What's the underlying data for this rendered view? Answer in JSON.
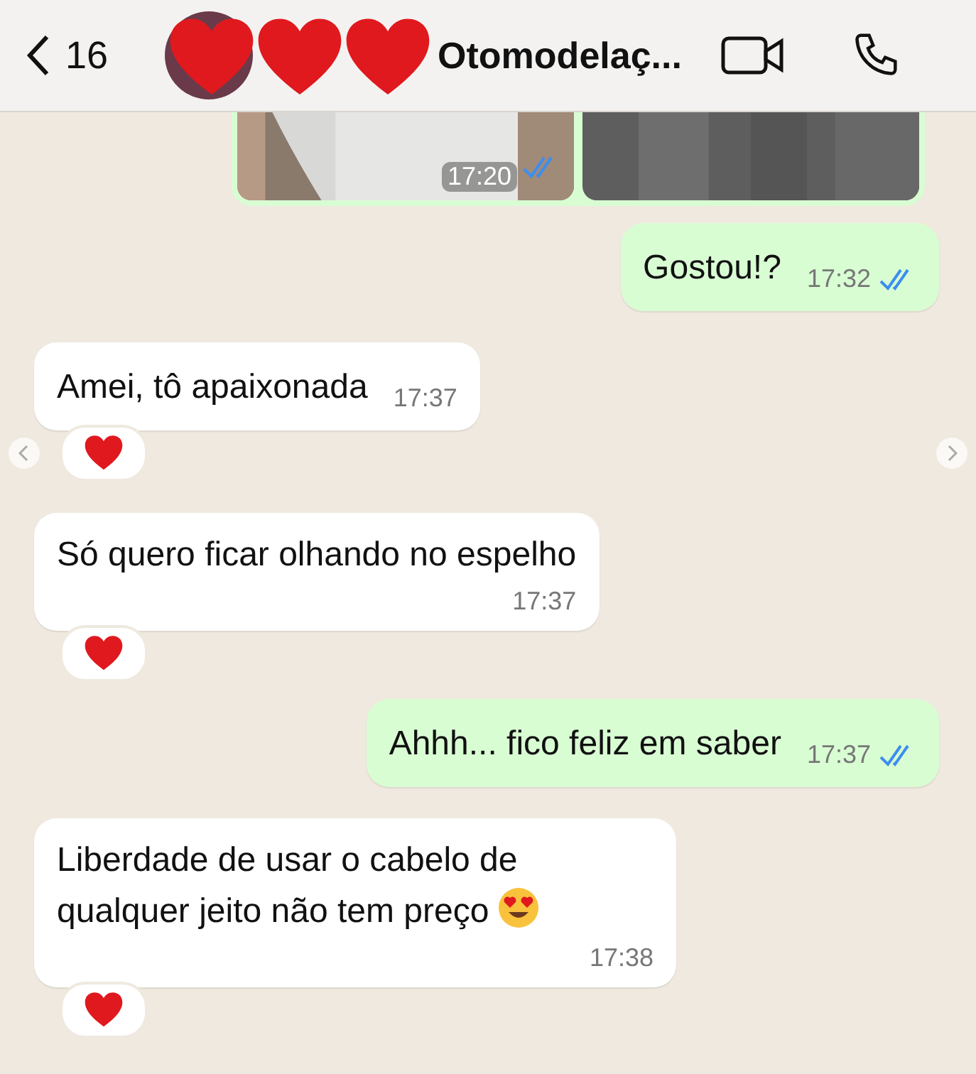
{
  "header": {
    "back_count": "16",
    "title": "Otomodelaç..."
  },
  "photo_message": {
    "time": "17:20",
    "read": true
  },
  "messages": [
    {
      "sent": true,
      "text": "Gostou!?",
      "time": "17:32",
      "read": true,
      "reacted": false
    },
    {
      "sent": false,
      "text": "Amei, tô apaixonada",
      "time": "17:37",
      "reacted": true
    },
    {
      "sent": false,
      "text": "Só quero ficar olhando no espelho",
      "time": "17:37",
      "reacted": true,
      "time_below": true
    },
    {
      "sent": true,
      "text": "Ahhh... fico feliz em saber",
      "time": "17:37",
      "read": true,
      "reacted": false
    },
    {
      "sent": false,
      "text": "Liberdade de usar o cabelo de qualquer jeito não tem preço",
      "time": "17:38",
      "reacted": true,
      "time_below": true,
      "heart_eyes_emoji": true
    }
  ]
}
